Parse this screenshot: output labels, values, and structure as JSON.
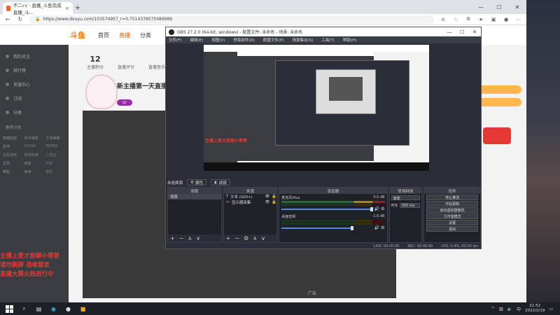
{
  "browser": {
    "tab_title": "不二cv · 直播_斗鱼完成直播_斗...",
    "url": "https://www.douyu.com/103574957_r=0.7514378075089989"
  },
  "douyu": {
    "nav": [
      "首页",
      "直播",
      "分类"
    ],
    "active_nav": "直播",
    "logo": "斗鱼",
    "stats": [
      {
        "num": "12",
        "label": "主播积分"
      },
      {
        "num": "",
        "label": "直播评分"
      },
      {
        "num": "",
        "label": "直播音乐"
      }
    ],
    "streamer_title": "新主播第一天直播",
    "vip_label": "LV",
    "sidebar_items": [
      "我的关注",
      "排行榜",
      "充值中心",
      "订阅",
      "分类"
    ],
    "sidebar_header": "推荐分类",
    "sidebar_grid": [
      "英雄联盟",
      "和平精英",
      "王者荣耀",
      "原神",
      "CS:GO",
      "DOTA2",
      "主机游戏",
      "单机热游",
      "二次元",
      "星秀",
      "颜值",
      "户外",
      "舞蹈",
      "美食",
      "音乐"
    ],
    "player_ad": "广告",
    "overlay_lines": [
      "主播上麦才能聊小哥哥",
      "请勿刷屏 违者禁言",
      "直播大赛火热进行中"
    ]
  },
  "obs": {
    "title": "OBS 27.2.0 (64-bit, windows) - 配置文件: 未命名 - 场景: 未命名",
    "menu": [
      "文件(F)",
      "编辑(E)",
      "视图(V)",
      "停靠部件(D)",
      "配置文件(P)",
      "场景集合(S)",
      "工具(T)",
      "帮助(H)"
    ],
    "bar_label": "未选择源",
    "bar_buttons": [
      "属性",
      "滤镜"
    ],
    "scenes_header": "场景",
    "scene_item": "场景",
    "sources_header": "来源",
    "sources": [
      "文本 (GDI+)",
      "显示器采集"
    ],
    "mixer_header": "混音器",
    "mixer": [
      {
        "name": "麦克风/Aux",
        "db": "0.0 dB"
      },
      {
        "name": "桌面音频",
        "db": "-1.6 dB"
      }
    ],
    "trans_header": "转场特效",
    "trans_type_label": "渐变",
    "trans_dur_label": "时长",
    "trans_dur_value": "300 ms",
    "ctrl_header": "控件",
    "controls": [
      "停止推流",
      "开始录制",
      "启动虚拟摄像机",
      "工作室模式",
      "设置",
      "退出"
    ],
    "status": [
      "LIVE: 00:00:00",
      "REC: 00:00:00",
      "CPU: 0.4%, 60.00 fps"
    ]
  },
  "taskbar": {
    "time": "21:52",
    "date": "2022/2/19"
  }
}
